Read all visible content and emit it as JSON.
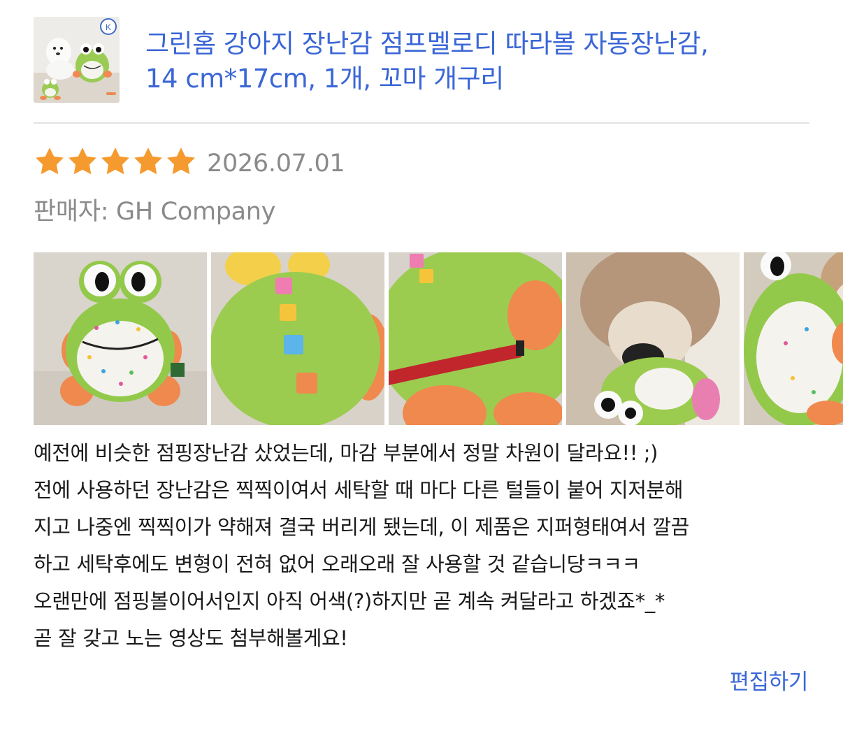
{
  "product": {
    "thumbnail_icon": "product-thumbnail-frog-toy",
    "title_lines": [
      "그린홈 강아지 장난감 점프멜로디 따라볼 자동장난감,",
      "14 cm*17cm, 1개, 꼬마 개구리"
    ]
  },
  "review": {
    "rating": 5,
    "rating_max": 5,
    "star_color": "#f59a2e",
    "date": "2026.07.01",
    "seller_label": "판매자:",
    "seller_name": "GH Company",
    "photos": [
      {
        "icon": "review-photo-frog-front"
      },
      {
        "icon": "review-photo-frog-back"
      },
      {
        "icon": "review-photo-frog-zipper"
      },
      {
        "icon": "review-photo-dog-with-toy"
      },
      {
        "icon": "review-photo-frog-dog-partial"
      }
    ],
    "body_lines": [
      "예전에 비슷한 점핑장난감 샀었는데, 마감 부분에서 정말 차원이 달라요!! ;)",
      "전에 사용하던 장난감은 찍찍이여서 세탁할 때 마다 다른 털들이 붙어 지저분해",
      "지고 나중엔 찍찍이가 약해져 결국 버리게 됐는데, 이 제품은 지퍼형태여서 깔끔",
      "하고 세탁후에도 변형이 전혀 없어 오래오래 잘 사용할 것 같습니당ㅋㅋㅋ",
      "오랜만에 점핑볼이어서인지 아직 어색(?)하지만 곧 계속 켜달라고 하겠죠*_*",
      "곧 잘 갖고 노는 영상도 첨부해볼게요!"
    ],
    "edit_label": "편집하기"
  },
  "colors": {
    "link": "#3a66d6",
    "muted_text": "#8a8a8a",
    "divider": "#e3e3e3"
  }
}
